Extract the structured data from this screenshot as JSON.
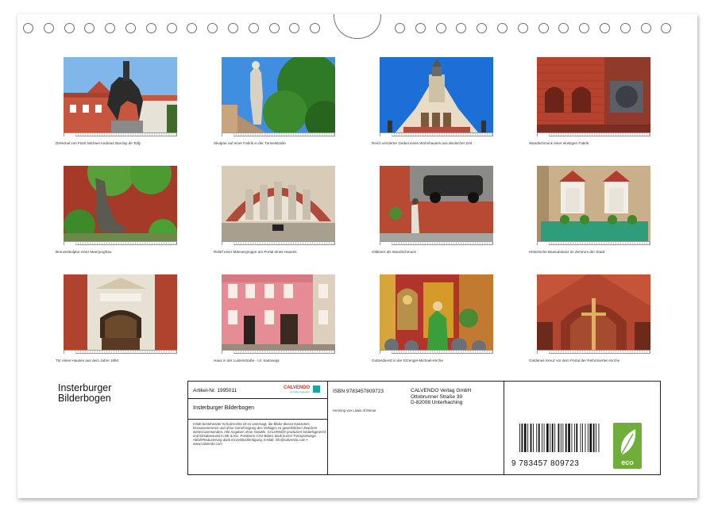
{
  "captions": [
    "Denkmal von Fürst Michael Andreas Barclay de Tolly",
    "Skulptur auf einer Fabrik in der Tunnelstraße",
    "Reich verzierter Giebel eines Wohnhauses aus deutscher Zeit",
    "Wandschmuck einer einstigen Fabrik",
    "Bronzeskulptur einer Meerjungfrau",
    "Relief einer Männergruppe am Portal eines Hauses",
    "Oldtimer als Wandschmuck",
    "Historische Bausubstanz im Zentrum der Stadt",
    "Tür eines Hauses aus dem Jahre 1894",
    "Haus in der Luisenstraße - Ul. Sadowaja",
    "Gottesdienst in der Erzengel-Michael-Kirche",
    "Goldenes Kreuz vor dem Portal der Reformierten Kirche"
  ],
  "title_line1": "Insterburger",
  "title_line2": "Bilderbogen",
  "article_no": "Artikel-Nr. 1995011",
  "brand_logo": "CALVENDO",
  "brand_tagline": "wir lieben kalender",
  "product_title": "Insterburger Bilderbogen",
  "legal_text": "Inhalt bestehender Schutzrechte ist es untersagt, die Bilder dieses Kalenders herauszutrennen und ohne Genehmigung des Verlages zu gewerblichen Zwecken weiterzuverwenden. Alle Angaben ohne Gewähr. CALVENDO produziert bedarfsgerecht und klimabewusst in DE & EU. Positivere CO2-Bilanz dank kurzer Transportwege. Abfall-Reduzierung dank Einzelstückfertigung. E-Mail: info@calvendo.com • www.calvendo.com",
  "isbn": "ISBN 9783457809723",
  "author": "Henning von Löwis of Menar",
  "publisher": [
    "CALVENDO Verlag GmbH",
    "Ottobrunner Straße 39",
    "D-82008 Unterhaching"
  ],
  "barcode_digits": "9 783457 809723",
  "eco_label": "eco",
  "colors": {
    "eco_green": "#6fae3a",
    "brand_teal": "#1aa4a4",
    "border": "#222222"
  }
}
